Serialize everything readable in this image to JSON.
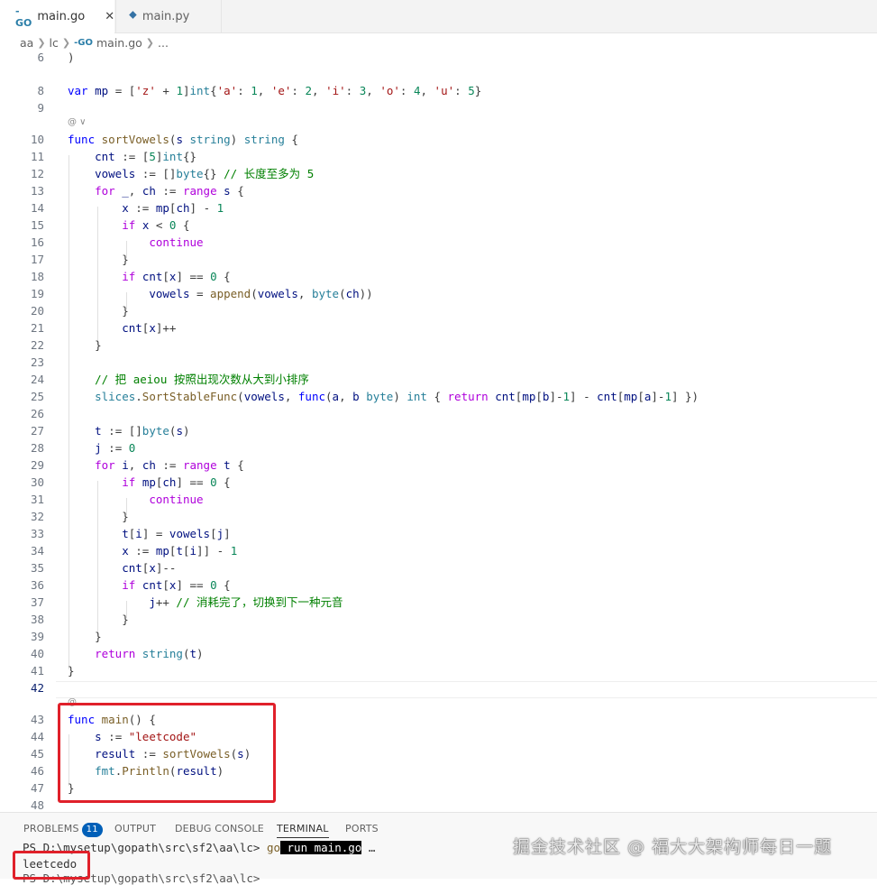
{
  "tabs": [
    {
      "label": "main.go",
      "icon": "go-file-icon",
      "active": true
    },
    {
      "label": "main.py",
      "icon": "python-file-icon",
      "active": false
    }
  ],
  "breadcrumb": {
    "segments": [
      "aa",
      "lc",
      "main.go",
      "..."
    ]
  },
  "code": {
    "lens": "@ ∨",
    "lens2": "@",
    "line_numbers": [
      "6",
      "8",
      "9",
      "10",
      "11",
      "12",
      "13",
      "14",
      "15",
      "16",
      "17",
      "18",
      "19",
      "20",
      "21",
      "22",
      "23",
      "24",
      "25",
      "26",
      "27",
      "28",
      "29",
      "30",
      "31",
      "32",
      "33",
      "34",
      "35",
      "36",
      "37",
      "38",
      "39",
      "40",
      "41",
      "42",
      "43",
      "44",
      "45",
      "46",
      "47",
      "48"
    ]
  },
  "panel": {
    "tabs": [
      "PROBLEMS",
      "OUTPUT",
      "DEBUG CONSOLE",
      "TERMINAL",
      "PORTS"
    ],
    "problems_count": "11",
    "terminal_prompt1": "PS D:\\mysetup\\gopath\\src\\sf2\\aa\\lc> ",
    "terminal_cmd": "go",
    "terminal_args": " run main.go",
    "terminal_ellipsis": " …",
    "output": "leetcedo",
    "terminal_prompt2": "PS D:\\mysetup\\gopath\\src\\sf2\\aa\\lc> "
  },
  "watermark": "掘金技术社区 @ 福大大架构师每日一题",
  "colors": {
    "highlight_box": "#e0202a",
    "keyword": "#0000ff",
    "comment": "#008000",
    "string": "#a31515",
    "number": "#098658",
    "function": "#795e26",
    "type": "#267f99"
  }
}
